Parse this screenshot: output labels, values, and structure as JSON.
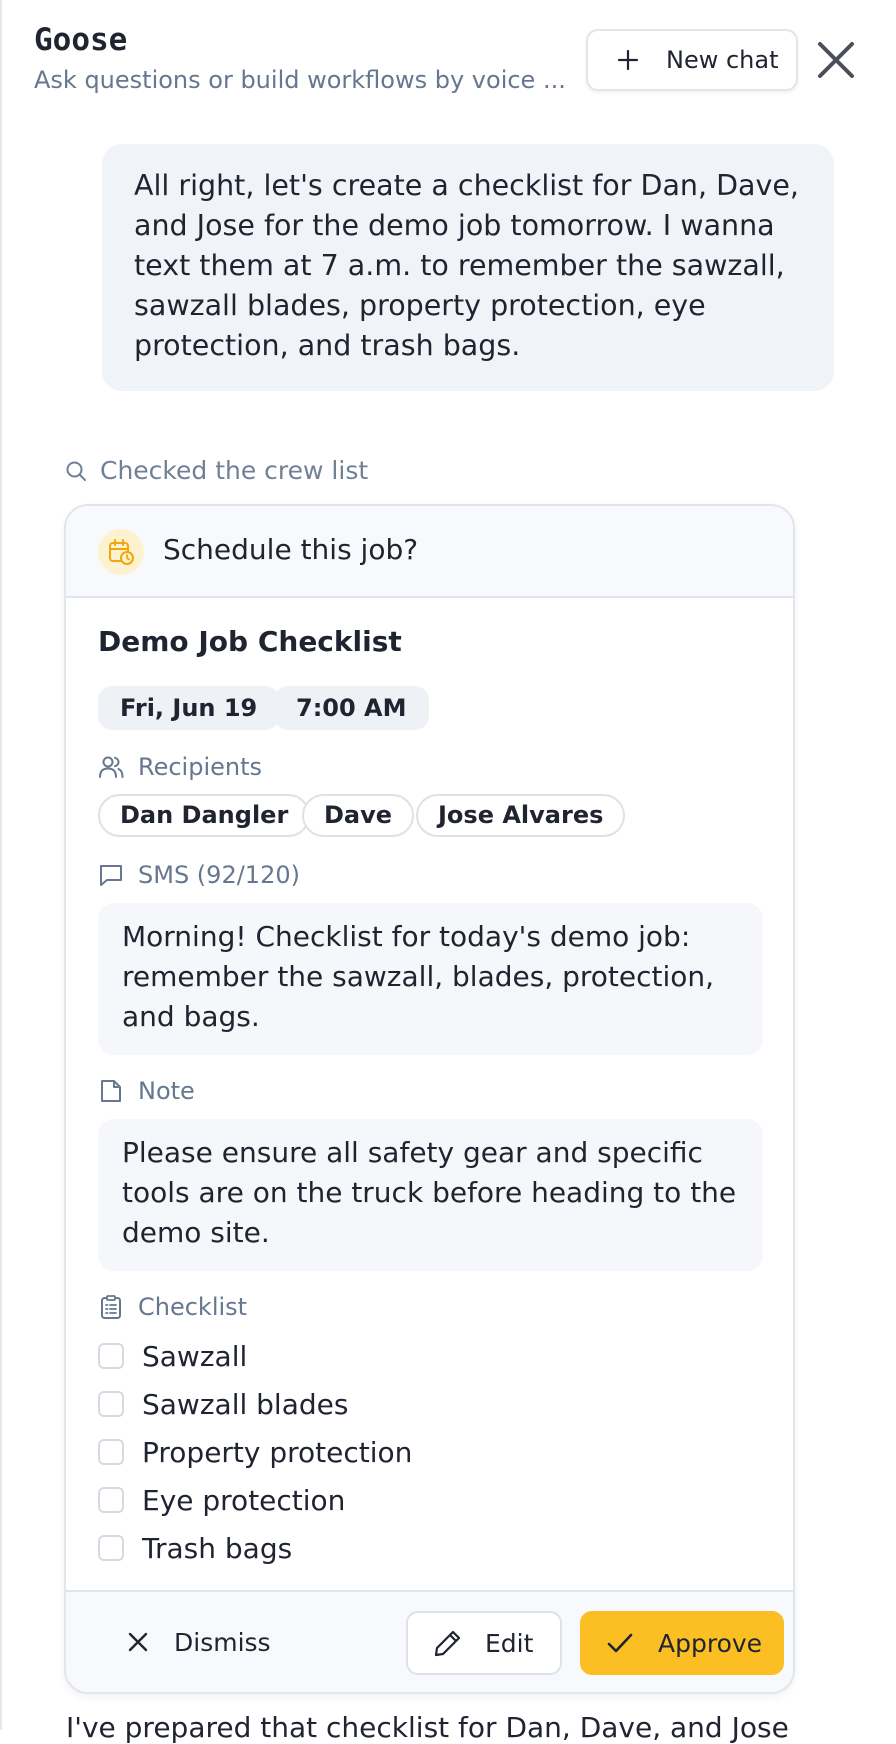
{
  "header": {
    "title": "Goose",
    "subtitle": "Ask questions or build workflows by voice ...",
    "new_chat_label": "New chat",
    "new_chat_icon": "plus-icon",
    "close_icon": "close-icon"
  },
  "conversation": {
    "user_message": "All right, let's create a checklist for Dan, Dave, and Jose for the demo job tomorrow. I wanna text them at 7 a.m. to remember the sawzall, sawzall blades, property protection, eye protection, and trash bags.",
    "tool_status": "Checked the crew list",
    "tool_status_icon": "search-icon",
    "assistant_reply_partial": "I've prepared that checklist for Dan, Dave, and Jose"
  },
  "card": {
    "header_title": "Schedule this job?",
    "header_icon": "calendar-clock-icon",
    "job_title": "Demo Job Checklist",
    "date": "Fri, Jun 19",
    "time": "7:00 AM",
    "recipients_label": "Recipients",
    "recipients": [
      "Dan Dangler",
      "Dave",
      "Jose Alvares"
    ],
    "sms_label": "SMS (92/120)",
    "sms_text": "Morning! Checklist for today's demo job: remember the sawzall, blades, protection, and bags.",
    "note_label": "Note",
    "note_text": "Please ensure all safety gear and specific tools are on the truck before heading to the demo site.",
    "checklist_label": "Checklist",
    "checklist": [
      {
        "label": "Sawzall",
        "checked": false
      },
      {
        "label": "Sawzall blades",
        "checked": false
      },
      {
        "label": "Property protection",
        "checked": false
      },
      {
        "label": "Eye protection",
        "checked": false
      },
      {
        "label": "Trash bags",
        "checked": false
      }
    ],
    "actions": {
      "dismiss": "Dismiss",
      "edit": "Edit",
      "approve": "Approve"
    }
  },
  "colors": {
    "accent": "#fbbf24",
    "muted_text": "#66778f",
    "bubble_bg": "#f0f3f8"
  }
}
